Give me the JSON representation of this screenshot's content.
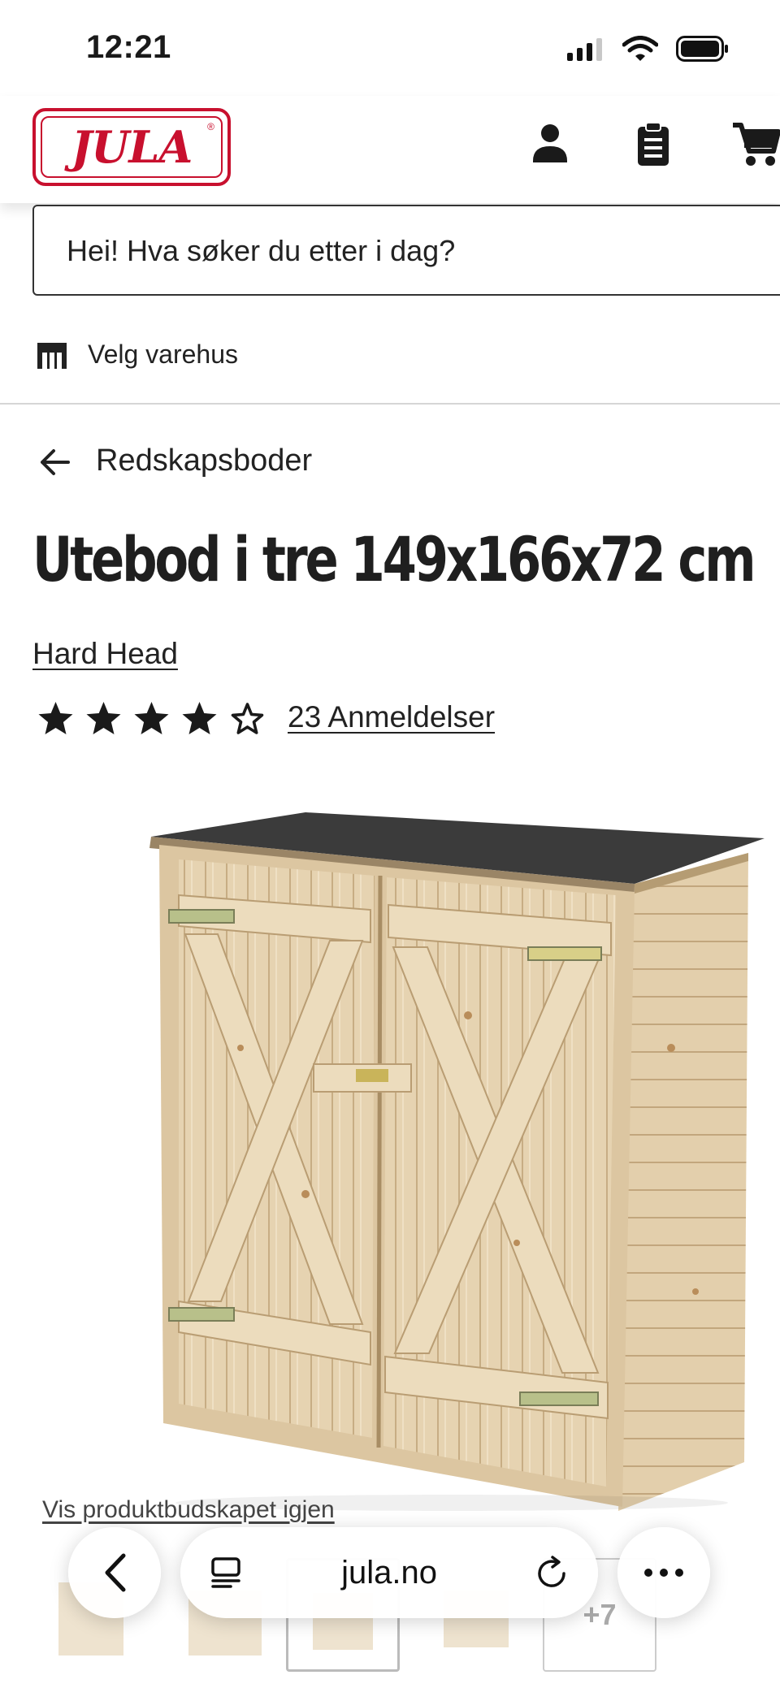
{
  "status_bar": {
    "time": "12:21"
  },
  "header": {
    "logo_text": "JULA",
    "logo_mark": "®"
  },
  "search": {
    "placeholder": "Hei! Hva søker du etter i dag?"
  },
  "store": {
    "label": "Velg varehus"
  },
  "breadcrumb": {
    "label": "Redskapsboder"
  },
  "product": {
    "title": "Utebod i tre 149x166x72 cm",
    "brand": "Hard Head",
    "rating": 4,
    "rating_max": 5,
    "reviews_label": "23 Anmeldelser",
    "image_alt": "wooden-storage-shed",
    "reshow_message_link": "Vis produktbudskapet igjen",
    "more_images": "+7"
  },
  "browser": {
    "url": "jula.no"
  },
  "colors": {
    "brand_red": "#c8102e",
    "text": "#1a1a1a"
  }
}
